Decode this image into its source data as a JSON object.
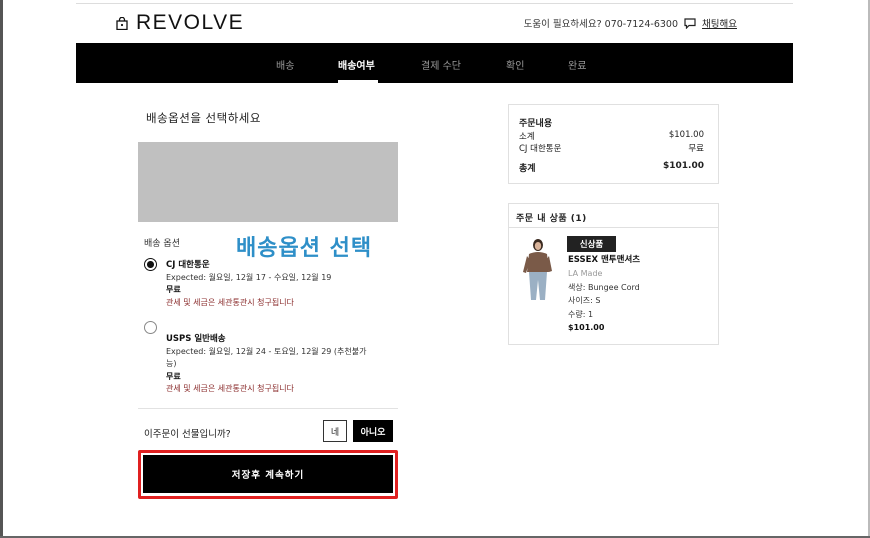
{
  "header": {
    "logo": "REVOLVE",
    "help_text": "도움이 필요하세요? 070-7124-6300",
    "chat_label": "채팅해요"
  },
  "nav": {
    "steps": [
      "배송",
      "배송여부",
      "결제 수단",
      "확인",
      "완료"
    ],
    "active_index": 1
  },
  "shipping": {
    "title": "배송옵션을 선택하세요",
    "options_label": "배송 옵션",
    "overlay_text": "배송옵션 선택",
    "options": [
      {
        "name": "CJ 대한통운",
        "expected": "Expected: 월요일, 12월 17 - 수요일, 12월 19",
        "fee": "무료",
        "note": "관세 및 세금은 세관통관시 청구됩니다",
        "selected": true
      },
      {
        "name": "USPS 일반배송",
        "expected_line1": "Expected: 월요일, 12월 24 - 토요일, 12월 29 (추천불가",
        "expected_line2": "능)",
        "fee": "무료",
        "note": "관세 및 세금은 세관통관시 청구됩니다",
        "selected": false
      }
    ],
    "gift_question": "이주문이 선물입니까?",
    "gift_yes": "네",
    "gift_no": "아니오",
    "continue_button": "저장후 계속하기"
  },
  "summary": {
    "title": "주문내용",
    "rows": [
      {
        "label": "소계",
        "value": "$101.00"
      },
      {
        "label": "CJ 대한통운",
        "value": "무료"
      }
    ],
    "total_label": "총계",
    "total_value": "$101.00"
  },
  "items": {
    "title": "주문 내 상품 (1)",
    "product": {
      "badge": "신상품",
      "name": "ESSEX 맨투맨셔츠",
      "brand": "LA Made",
      "color": "색상: Bungee Cord",
      "size": "사이즈: S",
      "qty": "수량: 1",
      "price": "$101.00"
    }
  },
  "colors": {
    "nav_bg": "#000000",
    "highlight_outline": "#e02020",
    "overlay_text": "#2e8fc8",
    "note_red": "#8b2d2d"
  }
}
